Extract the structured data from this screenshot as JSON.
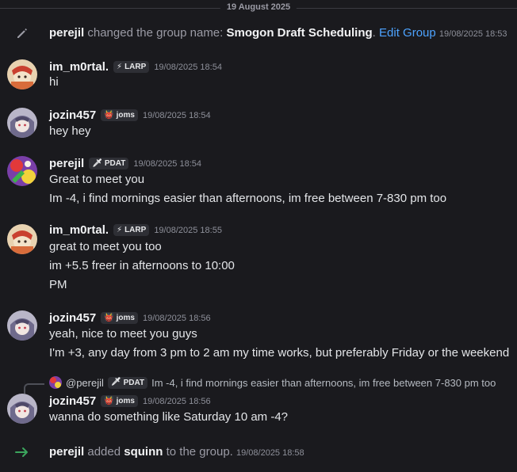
{
  "date_divider": "19 August 2025",
  "system_name_change": {
    "user": "perejil",
    "action": "changed the group name:",
    "group_name": "Smogon Draft Scheduling",
    "period": ".",
    "link": "Edit Group",
    "timestamp": "19/08/2025 18:53"
  },
  "messages": [
    {
      "user": "im_m0rtal.",
      "tag_icon": "⚡",
      "tag": "LARP",
      "timestamp": "19/08/2025 18:54",
      "lines": [
        "hi"
      ]
    },
    {
      "user": "jozin457",
      "tag_icon": "👹",
      "tag": "joms",
      "timestamp": "19/08/2025 18:54",
      "lines": [
        "hey hey"
      ]
    },
    {
      "user": "perejil",
      "tag_icon": "🗡",
      "tag": "PDAT",
      "timestamp": "19/08/2025 18:54",
      "lines": [
        "Great to meet you",
        "Im -4, i find mornings easier than afternoons, im free between 7-830 pm too"
      ]
    },
    {
      "user": "im_m0rtal.",
      "tag_icon": "⚡",
      "tag": "LARP",
      "timestamp": "19/08/2025 18:55",
      "lines": [
        "great to meet you too",
        "im +5.5 freer in afternoons to 10:00",
        "PM"
      ]
    },
    {
      "user": "jozin457",
      "tag_icon": "👹",
      "tag": "joms",
      "timestamp": "19/08/2025 18:56",
      "lines": [
        "yeah, nice to meet you guys",
        "I'm +3, any day from 3 pm to 2 am my time works, but preferably Friday or the weekend"
      ]
    },
    {
      "user": "jozin457",
      "tag_icon": "👹",
      "tag": "joms",
      "timestamp": "19/08/2025 18:56",
      "lines": [
        "wanna do something like Saturday 10 am -4?"
      ]
    }
  ],
  "reply": {
    "user": "@perejil",
    "tag_icon": "🗡",
    "tag": "PDAT",
    "text": "Im -4, i find mornings easier than afternoons, im free between 7-830 pm too"
  },
  "system_add": {
    "user": "perejil",
    "action": "added",
    "target": "squinn",
    "rest": "to the group.",
    "timestamp": "19/08/2025 18:58"
  },
  "colors": {
    "background": "#1a1a1e",
    "link": "#4da3ff",
    "join_arrow": "#3ba55d"
  }
}
